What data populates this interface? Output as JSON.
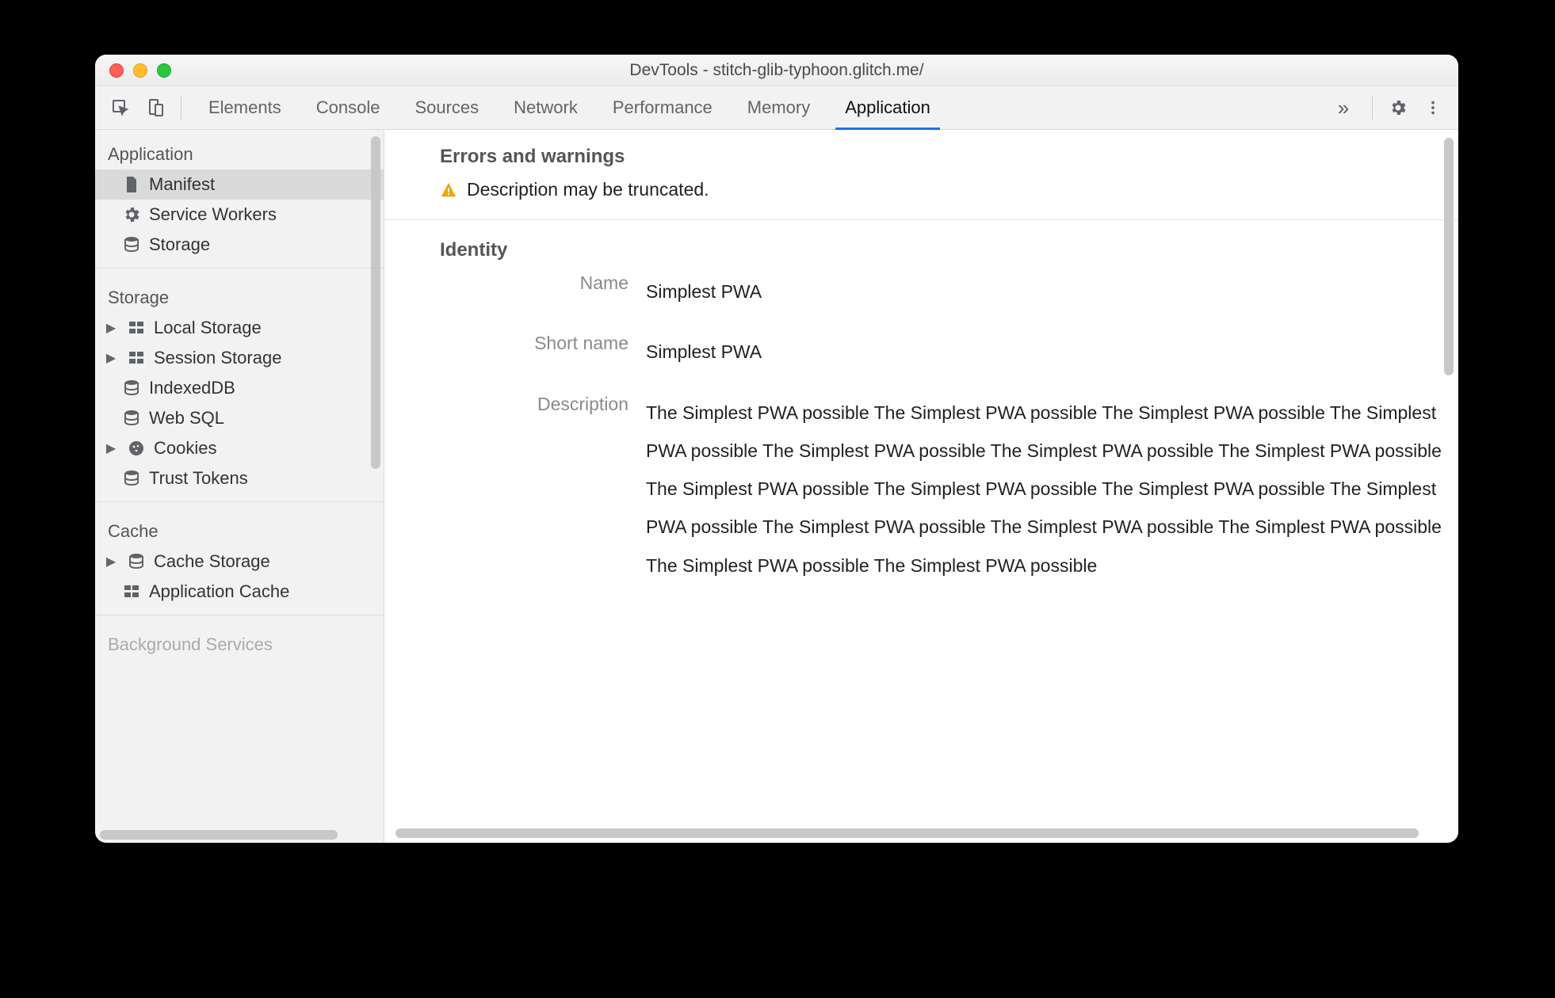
{
  "window": {
    "title": "DevTools - stitch-glib-typhoon.glitch.me/"
  },
  "toolbar": {
    "tabs": [
      {
        "label": "Elements",
        "active": false
      },
      {
        "label": "Console",
        "active": false
      },
      {
        "label": "Sources",
        "active": false
      },
      {
        "label": "Network",
        "active": false
      },
      {
        "label": "Performance",
        "active": false
      },
      {
        "label": "Memory",
        "active": false
      },
      {
        "label": "Application",
        "active": true
      }
    ],
    "icons": {
      "inspect": "inspect-icon",
      "device": "device-toggle-icon",
      "overflow": "chevron-double-right-icon",
      "settings": "gear-icon",
      "kebab": "kebab-menu-icon"
    }
  },
  "sidebar": {
    "sections": [
      {
        "title": "Application",
        "items": [
          {
            "label": "Manifest",
            "icon": "file-icon",
            "selected": true,
            "expandable": false
          },
          {
            "label": "Service Workers",
            "icon": "gear-icon",
            "selected": false,
            "expandable": false
          },
          {
            "label": "Storage",
            "icon": "database-icon",
            "selected": false,
            "expandable": false
          }
        ]
      },
      {
        "title": "Storage",
        "items": [
          {
            "label": "Local Storage",
            "icon": "grid-icon",
            "expandable": true
          },
          {
            "label": "Session Storage",
            "icon": "grid-icon",
            "expandable": true
          },
          {
            "label": "IndexedDB",
            "icon": "database-icon",
            "expandable": false
          },
          {
            "label": "Web SQL",
            "icon": "database-icon",
            "expandable": false
          },
          {
            "label": "Cookies",
            "icon": "cookie-icon",
            "expandable": true
          },
          {
            "label": "Trust Tokens",
            "icon": "database-icon",
            "expandable": false
          }
        ]
      },
      {
        "title": "Cache",
        "items": [
          {
            "label": "Cache Storage",
            "icon": "database-icon",
            "expandable": true
          },
          {
            "label": "Application Cache",
            "icon": "grid-icon",
            "expandable": false
          }
        ]
      },
      {
        "title": "Background Services",
        "items": []
      }
    ]
  },
  "manifest": {
    "errors_heading": "Errors and warnings",
    "warnings": [
      "Description may be truncated."
    ],
    "identity_heading": "Identity",
    "identity": {
      "name_label": "Name",
      "name": "Simplest PWA",
      "short_name_label": "Short name",
      "short_name": "Simplest PWA",
      "description_label": "Description",
      "description": "The Simplest PWA possible The Simplest PWA possible The Simplest PWA possible The Simplest PWA possible The Simplest PWA possible The Simplest PWA possible The Simplest PWA possible The Simplest PWA possible The Simplest PWA possible The Simplest PWA possible The Simplest PWA possible The Simplest PWA possible The Simplest PWA possible The Simplest PWA possible The Simplest PWA possible The Simplest PWA possible"
    }
  },
  "colors": {
    "accent": "#1a73e8",
    "warning": "#f0a30a"
  }
}
